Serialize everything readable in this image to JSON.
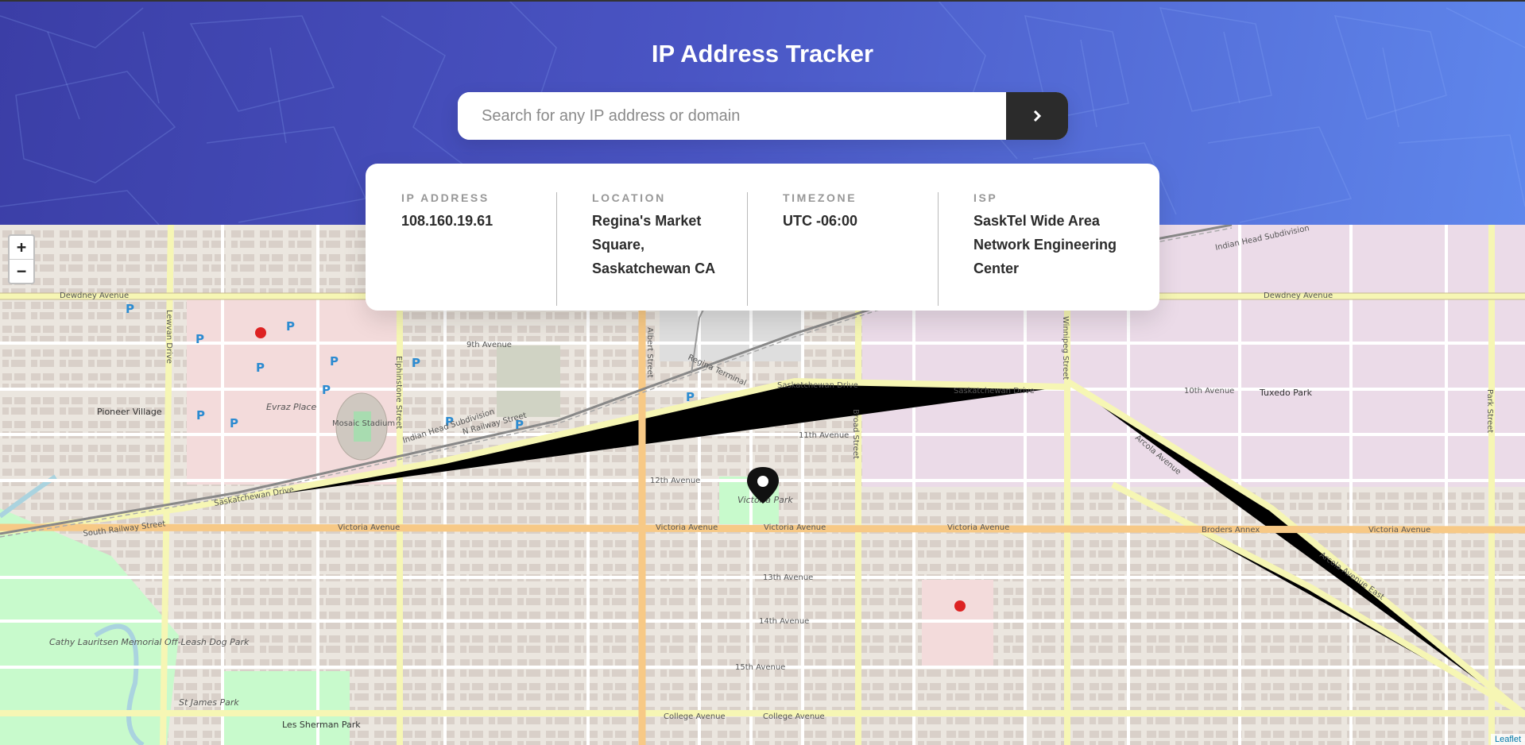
{
  "header": {
    "title": "IP Address Tracker"
  },
  "search": {
    "placeholder": "Search for any IP address or domain",
    "value": "",
    "button_icon": "chevron-right-icon"
  },
  "info": [
    {
      "label": "IP ADDRESS",
      "value": "108.160.19.61"
    },
    {
      "label": "LOCATION",
      "value": "Regina's Market Square, Saskatchewan CA"
    },
    {
      "label": "TIMEZONE",
      "value": "UTC -06:00"
    },
    {
      "label": "ISP",
      "value": "SaskTel Wide Area Network Engineering Center"
    }
  ],
  "map": {
    "zoom_in": "+",
    "zoom_out": "−",
    "attribution": "Leaflet",
    "labels": {
      "dewdney_left": "Dewdney Avenue",
      "dewdney_right": "Dewdney Avenue",
      "saskatchewan_drive": "Saskatchewan Drive",
      "saskatchewan_drive_2": "Saskatchewan Drive",
      "saskatchewan_drive_3": "Saskatchewan Drive",
      "victoria_1": "Victoria Avenue",
      "victoria_2": "Victoria Avenue",
      "victoria_3": "Victoria Avenue",
      "victoria_4": "Victoria Avenue",
      "victoria_5": "Victoria Avenue",
      "albert_street": "Albert Street",
      "broad_street": "Broad Street",
      "winnipeg_street": "Winnipeg Street",
      "park_street": "Park Street",
      "lewvan_drive": "Lewvan Drive",
      "elphinstone_street": "Elphinstone Street",
      "twelfth_avenue": "12th Avenue",
      "eleventh_avenue": "11th Avenue",
      "thirteenth_avenue": "13th Avenue",
      "fourteenth_avenue": "14th Avenue",
      "fifteenth_avenue": "15th Avenue",
      "college_avenue": "College Avenue",
      "college_avenue_2": "College Avenue",
      "arcola_avenue": "Arcola Avenue",
      "arcola_avenue_east": "Arcola Avenue East",
      "evraz_place": "Evraz Place",
      "mosaic_stadium": "Mosaic Stadium",
      "pioneer_village": "Pioneer Village",
      "tuxedo_park": "Tuxedo Park",
      "victoria_park": "Victoria Park",
      "cathy_lauritsen": "Cathy Lauritsen Memorial Off-Leash Dog Park",
      "les_sherman": "Les Sherman Park",
      "st_james": "St James Park",
      "broders_annex": "Broders Annex",
      "indian_head": "Indian Head Subdivision",
      "indian_head_2": "Indian Head Subdivision",
      "south_railway": "South Railway Street",
      "n_railway": "N Railway Street",
      "tenth_avenue": "10th Avenue",
      "ninth_avenue": "9th Avenue",
      "regina_terminal": "Regina Terminal"
    },
    "colors": {
      "major_road": "#f7c986",
      "secondary_road": "#f6f6b4",
      "industrial": "#ebdbe8",
      "park": "#c8facc",
      "hospital": "#f3dbdb",
      "building": "#d9d0c9",
      "marker": "#111111"
    }
  }
}
